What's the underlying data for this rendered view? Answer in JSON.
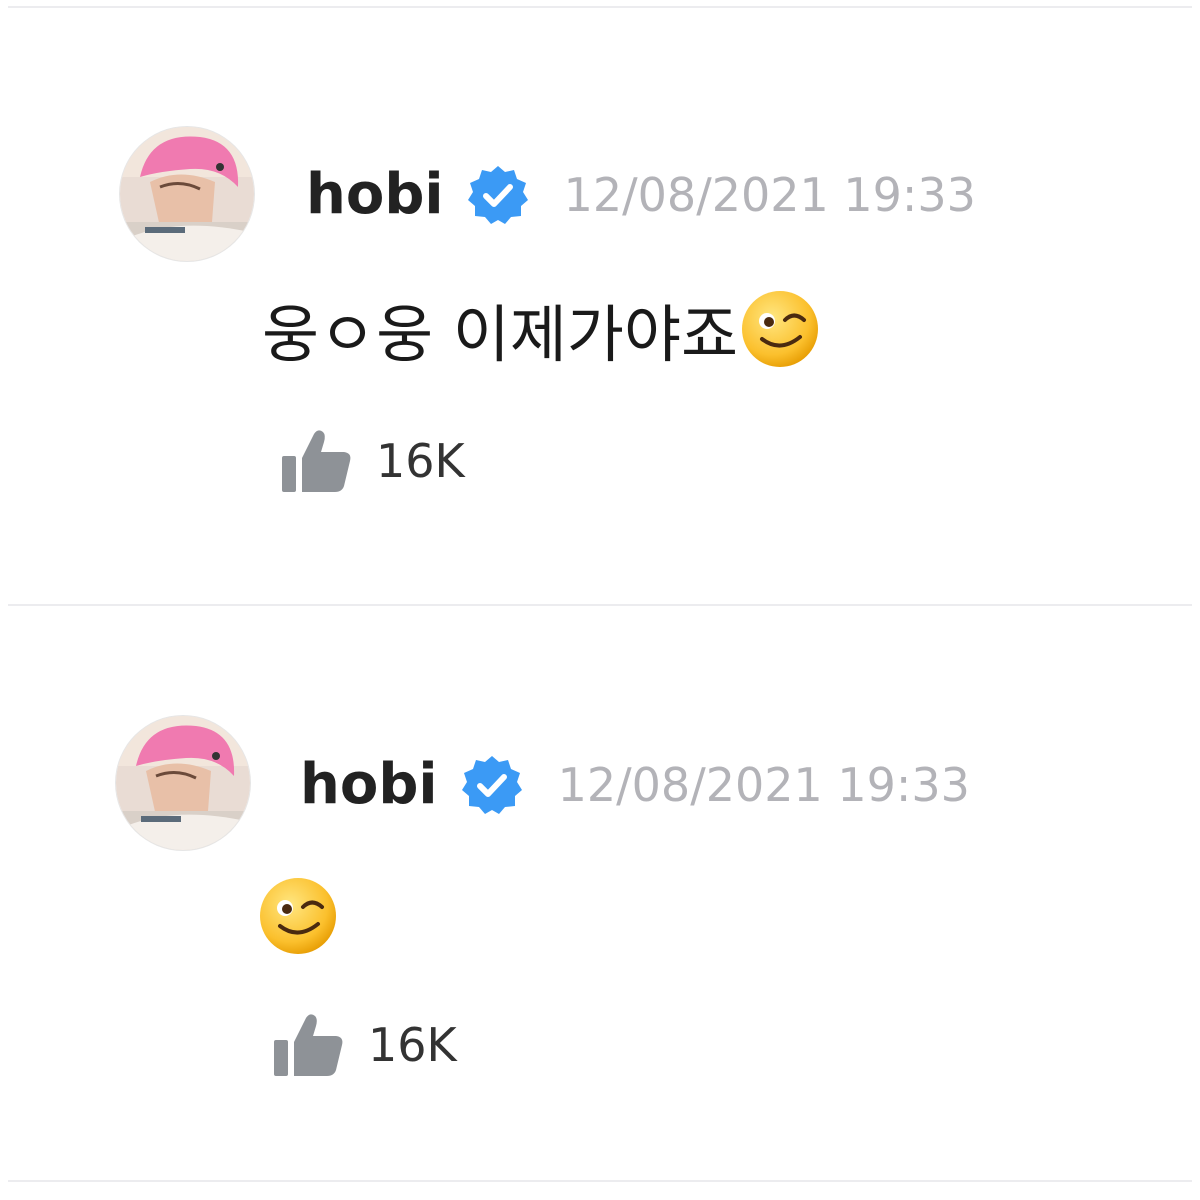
{
  "comments": [
    {
      "username": "hobi",
      "verified_icon": "verified-badge-icon",
      "timestamp": "12/08/2021 19:33",
      "text": "웅ㅇ웅 이제가야죠",
      "emoji_icon": "winking-face-emoji",
      "like_icon": "thumbs-up-icon",
      "likes": "16K"
    },
    {
      "username": "hobi",
      "verified_icon": "verified-badge-icon",
      "timestamp": "12/08/2021 19:33",
      "text": "",
      "emoji_icon": "winking-face-emoji",
      "like_icon": "thumbs-up-icon",
      "likes": "16K"
    }
  ],
  "colors": {
    "verified": "#3b9af5",
    "timestamp": "#b3b3b8",
    "like_icon": "#8e9297",
    "divider": "#ececef"
  }
}
